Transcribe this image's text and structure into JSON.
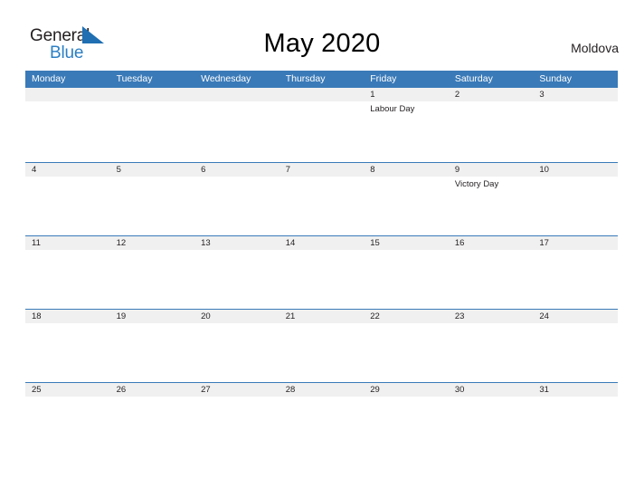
{
  "header": {
    "logo": {
      "word1": "General",
      "word2": "Blue",
      "flag_icon": "blue-flag-triangle",
      "word1_color": "#231f20",
      "word2_color": "#2b7fc4",
      "flag_color": "#1f6fb2"
    },
    "title": "May 2020",
    "country": "Moldova"
  },
  "colors": {
    "header_blue": "#3a7ab8",
    "date_band_gray": "#f0f0f0",
    "row_border_blue": "#3a7ab8",
    "text": "#231f20",
    "page_background": "#ffffff"
  },
  "calendar": {
    "month": "May",
    "year": "2020",
    "first_day_of_week": "Monday",
    "day_names": [
      "Monday",
      "Tuesday",
      "Wednesday",
      "Thursday",
      "Friday",
      "Saturday",
      "Sunday"
    ],
    "weeks": [
      {
        "days": [
          {
            "date": "",
            "event": ""
          },
          {
            "date": "",
            "event": ""
          },
          {
            "date": "",
            "event": ""
          },
          {
            "date": "",
            "event": ""
          },
          {
            "date": "1",
            "event": "Labour Day"
          },
          {
            "date": "2",
            "event": ""
          },
          {
            "date": "3",
            "event": ""
          }
        ]
      },
      {
        "days": [
          {
            "date": "4",
            "event": ""
          },
          {
            "date": "5",
            "event": ""
          },
          {
            "date": "6",
            "event": ""
          },
          {
            "date": "7",
            "event": ""
          },
          {
            "date": "8",
            "event": ""
          },
          {
            "date": "9",
            "event": "Victory Day"
          },
          {
            "date": "10",
            "event": ""
          }
        ]
      },
      {
        "days": [
          {
            "date": "11",
            "event": ""
          },
          {
            "date": "12",
            "event": ""
          },
          {
            "date": "13",
            "event": ""
          },
          {
            "date": "14",
            "event": ""
          },
          {
            "date": "15",
            "event": ""
          },
          {
            "date": "16",
            "event": ""
          },
          {
            "date": "17",
            "event": ""
          }
        ]
      },
      {
        "days": [
          {
            "date": "18",
            "event": ""
          },
          {
            "date": "19",
            "event": ""
          },
          {
            "date": "20",
            "event": ""
          },
          {
            "date": "21",
            "event": ""
          },
          {
            "date": "22",
            "event": ""
          },
          {
            "date": "23",
            "event": ""
          },
          {
            "date": "24",
            "event": ""
          }
        ]
      },
      {
        "days": [
          {
            "date": "25",
            "event": ""
          },
          {
            "date": "26",
            "event": ""
          },
          {
            "date": "27",
            "event": ""
          },
          {
            "date": "28",
            "event": ""
          },
          {
            "date": "29",
            "event": ""
          },
          {
            "date": "30",
            "event": ""
          },
          {
            "date": "31",
            "event": ""
          }
        ]
      }
    ],
    "holidays": [
      {
        "date": "1",
        "name": "Labour Day",
        "weekday": "Friday"
      },
      {
        "date": "9",
        "name": "Victory Day",
        "weekday": "Saturday"
      }
    ]
  }
}
